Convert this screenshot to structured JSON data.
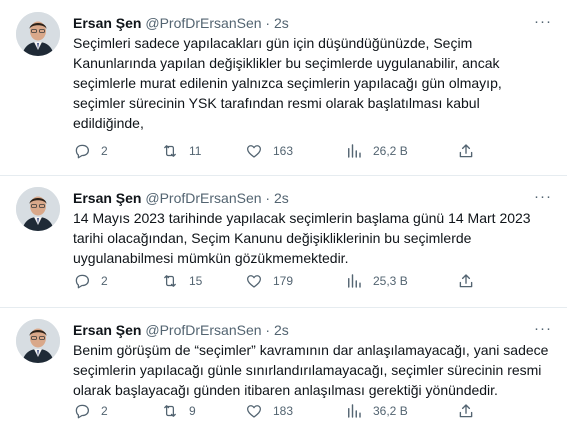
{
  "tweets": [
    {
      "name": "Ersan Şen",
      "handle": "@ProfDrErsanSen",
      "dot": "·",
      "time": "2s",
      "more": "···",
      "text": "Seçimleri sadece yapılacakları gün için düşündüğünüzde, Seçim Kanunlarında yapılan değişiklikler bu seçimlerde uygulanabilir, ancak seçimlerle murat edilenin yalnızca seçimlerin yapılacağı gün olmayıp, seçimler sürecinin YSK tarafından resmi olarak başlatılması kabul edildiğinde,",
      "replies": "2",
      "retweets": "11",
      "likes": "163",
      "views": "26,2 B"
    },
    {
      "name": "Ersan Şen",
      "handle": "@ProfDrErsanSen",
      "dot": "·",
      "time": "2s",
      "more": "···",
      "text": "14 Mayıs 2023 tarihinde yapılacak seçimlerin başlama günü 14 Mart 2023 tarihi olacağından, Seçim Kanunu değişikliklerinin bu seçimlerde uygulanabilmesi mümkün gözükmemektedir.",
      "replies": "2",
      "retweets": "15",
      "likes": "179",
      "views": "25,3 B"
    },
    {
      "name": "Ersan Şen",
      "handle": "@ProfDrErsanSen",
      "dot": "·",
      "time": "2s",
      "more": "···",
      "text": "Benim görüşüm de “seçimler” kavramının dar anlaşılamayacağı, yani sadece seçimlerin yapılacağı günle sınırlandırılamayacağı, seçimler sürecinin resmi olarak başlayacağı günden itibaren anlaşılması gerektiği yönündedir.",
      "replies": "2",
      "retweets": "9",
      "likes": "183",
      "views": "36,2 B"
    }
  ],
  "colors": {
    "text": "#0f1419",
    "muted": "#536471",
    "divider": "#e6ecf0"
  },
  "icons": [
    "avatar",
    "more-icon",
    "reply-icon",
    "retweet-icon",
    "like-icon",
    "views-icon",
    "share-icon"
  ]
}
